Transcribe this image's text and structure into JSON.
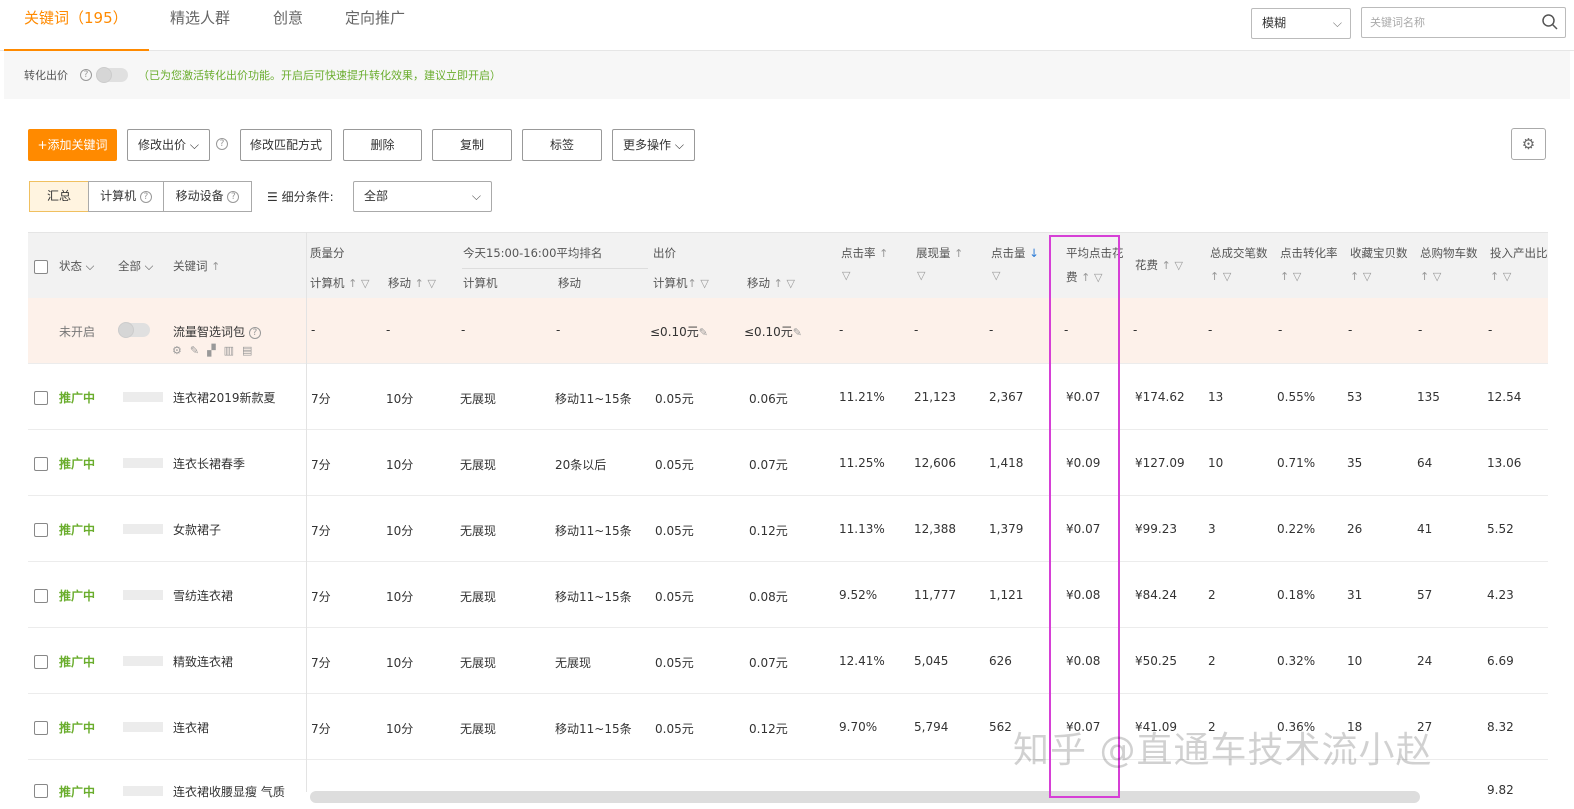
{
  "tabs": [
    {
      "label": "关键词（195）",
      "active": true
    },
    {
      "label": "精选人群"
    },
    {
      "label": "创意"
    },
    {
      "label": "定向推广"
    }
  ],
  "match_type": {
    "value": "模糊"
  },
  "search": {
    "placeholder": "关键词名称"
  },
  "notice": {
    "label": "转化出价",
    "hint": "（已为您激活转化出价功能。开启后可快速提升转化效果，建议立即开启）"
  },
  "toolbar": {
    "add_keyword": "+添加关键词",
    "modify_bid": "修改出价",
    "modify_match": "修改匹配方式",
    "delete": "删除",
    "copy": "复制",
    "tag": "标签",
    "more": "更多操作"
  },
  "segments": {
    "summary": "汇总",
    "computer": "计算机",
    "mobile": "移动设备",
    "filter_label": "细分条件:",
    "filter_value": "全部"
  },
  "columns": {
    "status": "状态",
    "all": "全部",
    "keyword": "关键词",
    "quality": "质量分",
    "quality_pc": "计算机",
    "quality_mobile": "移动",
    "rank": "今天15:00-16:00平均排名",
    "rank_pc": "计算机",
    "rank_mobile": "移动",
    "bid": "出价",
    "bid_pc": "计算机",
    "bid_mobile": "移动",
    "ctr": "点击率",
    "impressions": "展现量",
    "clicks": "点击量",
    "avg_cpc_1": "平均点击花",
    "avg_cpc_2": "费",
    "cost": "花费",
    "orders": "总成交笔数",
    "cvr": "点击转化率",
    "favs": "收藏宝贝数",
    "cart": "总购物车数",
    "roi": "投入产出比"
  },
  "package_row": {
    "status": "未开启",
    "name": "流量智选词包",
    "quality_pc": "-",
    "quality_mobile": "-",
    "rank_pc": "-",
    "rank_mobile": "-",
    "bid_pc": "≤0.10元",
    "bid_mobile": "≤0.10元",
    "ctr": "-",
    "impressions": "-",
    "clicks": "-",
    "avg_cpc": "-",
    "cost": "-",
    "orders": "-",
    "cvr": "-",
    "favs": "-",
    "cart": "-",
    "roi": "-"
  },
  "rows": [
    {
      "status": "推广中",
      "keyword": "连衣裙2019新款夏",
      "quality_pc": "7分",
      "quality_mobile": "10分",
      "rank_pc": "无展现",
      "rank_mobile": "移动11~15条",
      "bid_pc": "0.05元",
      "bid_mobile": "0.06元",
      "ctr": "11.21%",
      "impressions": "21,123",
      "clicks": "2,367",
      "avg_cpc": "¥0.07",
      "cost": "¥174.62",
      "orders": "13",
      "cvr": "0.55%",
      "favs": "53",
      "cart": "135",
      "roi": "12.54"
    },
    {
      "status": "推广中",
      "keyword": "连衣长裙春季",
      "quality_pc": "7分",
      "quality_mobile": "10分",
      "rank_pc": "无展现",
      "rank_mobile": "20条以后",
      "bid_pc": "0.05元",
      "bid_mobile": "0.07元",
      "ctr": "11.25%",
      "impressions": "12,606",
      "clicks": "1,418",
      "avg_cpc": "¥0.09",
      "cost": "¥127.09",
      "orders": "10",
      "cvr": "0.71%",
      "favs": "35",
      "cart": "64",
      "roi": "13.06"
    },
    {
      "status": "推广中",
      "keyword": "女款裙子",
      "quality_pc": "7分",
      "quality_mobile": "10分",
      "rank_pc": "无展现",
      "rank_mobile": "移动11~15条",
      "bid_pc": "0.05元",
      "bid_mobile": "0.12元",
      "ctr": "11.13%",
      "impressions": "12,388",
      "clicks": "1,379",
      "avg_cpc": "¥0.07",
      "cost": "¥99.23",
      "orders": "3",
      "cvr": "0.22%",
      "favs": "26",
      "cart": "41",
      "roi": "5.52"
    },
    {
      "status": "推广中",
      "keyword": "雪纺连衣裙",
      "quality_pc": "7分",
      "quality_mobile": "10分",
      "rank_pc": "无展现",
      "rank_mobile": "移动11~15条",
      "bid_pc": "0.05元",
      "bid_mobile": "0.08元",
      "ctr": "9.52%",
      "impressions": "11,777",
      "clicks": "1,121",
      "avg_cpc": "¥0.08",
      "cost": "¥84.24",
      "orders": "2",
      "cvr": "0.18%",
      "favs": "31",
      "cart": "57",
      "roi": "4.23"
    },
    {
      "status": "推广中",
      "keyword": "精致连衣裙",
      "quality_pc": "7分",
      "quality_mobile": "10分",
      "rank_pc": "无展现",
      "rank_mobile": "无展现",
      "bid_pc": "0.05元",
      "bid_mobile": "0.07元",
      "ctr": "12.41%",
      "impressions": "5,045",
      "clicks": "626",
      "avg_cpc": "¥0.08",
      "cost": "¥50.25",
      "orders": "2",
      "cvr": "0.32%",
      "favs": "10",
      "cart": "24",
      "roi": "6.69"
    },
    {
      "status": "推广中",
      "keyword": "连衣裙",
      "quality_pc": "7分",
      "quality_mobile": "10分",
      "rank_pc": "无展现",
      "rank_mobile": "移动11~15条",
      "bid_pc": "0.05元",
      "bid_mobile": "0.12元",
      "ctr": "9.70%",
      "impressions": "5,794",
      "clicks": "562",
      "avg_cpc": "¥0.07",
      "cost": "¥41.09",
      "orders": "2",
      "cvr": "0.36%",
      "favs": "18",
      "cart": "27",
      "roi": "8.32"
    },
    {
      "status": "推广中",
      "keyword": "连衣裙收腰显瘦 气质",
      "quality_pc": "",
      "quality_mobile": "",
      "rank_pc": "",
      "rank_mobile": "",
      "bid_pc": "",
      "bid_mobile": "",
      "ctr": "",
      "impressions": "",
      "clicks": "",
      "avg_cpc": "",
      "cost": "",
      "orders": "",
      "cvr": "",
      "favs": "",
      "cart": "",
      "roi": "9.82"
    }
  ],
  "watermark": "知乎 @直通车技术流小赵",
  "colors": {
    "accent": "#ff8a00",
    "status_on": "#6aad2d",
    "highlight": "#d63fd6"
  }
}
